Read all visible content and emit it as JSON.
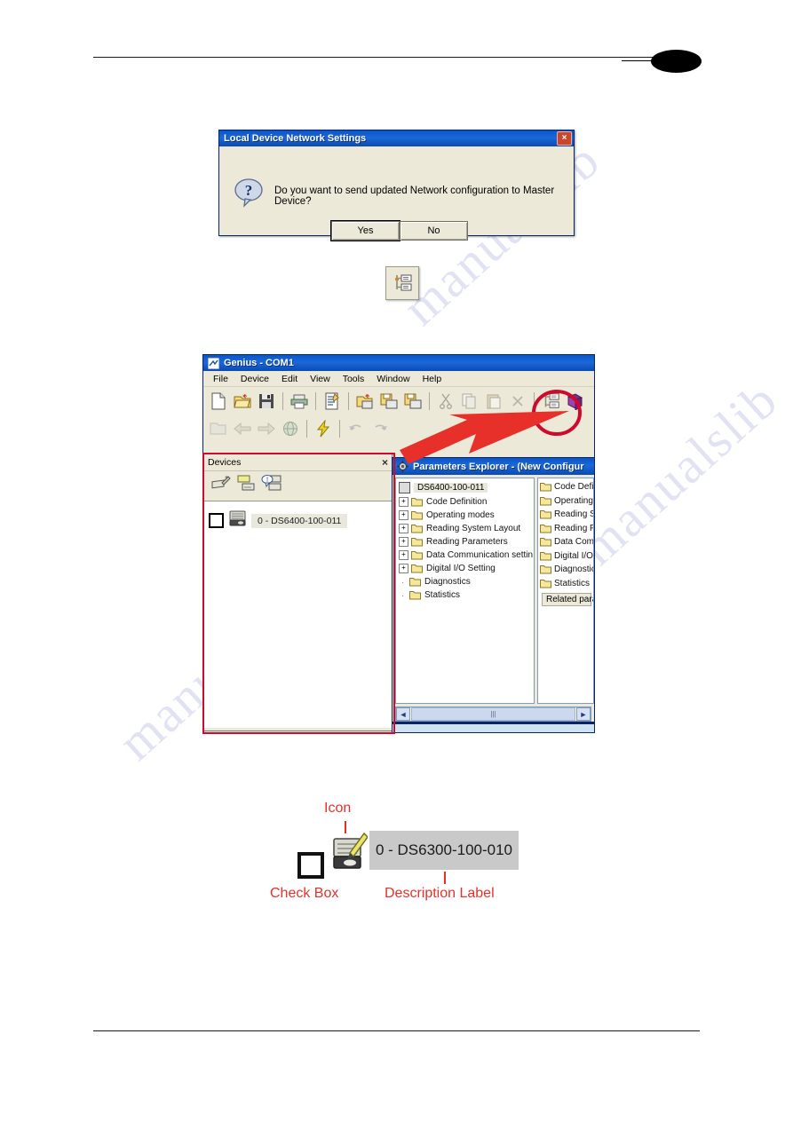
{
  "dialog": {
    "title": "Local Device Network Settings",
    "message": "Do you want to send updated Network configuration to Master Device?",
    "yes_label": "Yes",
    "no_label": "No",
    "close_label": "×",
    "icon": "question-icon"
  },
  "standalone_icon": {
    "name": "network-settings-icon"
  },
  "app": {
    "title": "Genius - COM1",
    "menu": [
      {
        "label": "File"
      },
      {
        "label": "Device"
      },
      {
        "label": "Edit"
      },
      {
        "label": "View"
      },
      {
        "label": "Tools"
      },
      {
        "label": "Window"
      },
      {
        "label": "Help"
      }
    ],
    "toolbar_row1": [
      {
        "name": "new-document-icon"
      },
      {
        "name": "open-folder-icon"
      },
      {
        "name": "save-icon"
      },
      {
        "name": "print-icon"
      },
      {
        "name": "properties-icon"
      },
      {
        "name": "open-from-device-icon"
      },
      {
        "name": "save-to-device-icon"
      },
      {
        "name": "save-all-icon"
      },
      {
        "name": "cut-icon"
      },
      {
        "name": "copy-icon"
      },
      {
        "name": "paste-icon"
      },
      {
        "name": "delete-icon"
      },
      {
        "name": "network-settings-icon"
      },
      {
        "name": "help-book-icon"
      }
    ],
    "toolbar_row2": [
      {
        "name": "open-config-icon"
      },
      {
        "name": "back-arrow-icon"
      },
      {
        "name": "forward-arrow-icon"
      },
      {
        "name": "globe-icon"
      },
      {
        "name": "lightning-icon"
      },
      {
        "name": "undo-icon"
      },
      {
        "name": "redo-icon"
      }
    ]
  },
  "devices_panel": {
    "title": "Devices",
    "close_label": "×",
    "tools": [
      {
        "name": "add-device-icon"
      },
      {
        "name": "device-list-icon"
      },
      {
        "name": "device-info-icon"
      }
    ],
    "device": {
      "label": "0 - DS6400-100-011",
      "checked": false
    }
  },
  "parameters_explorer": {
    "title": "Parameters Explorer - (New Configur",
    "root_label": "DS6400-100-011",
    "tree": [
      {
        "label": "Code Definition",
        "expandable": true
      },
      {
        "label": "Operating modes",
        "expandable": true
      },
      {
        "label": "Reading System Layout",
        "expandable": true
      },
      {
        "label": "Reading Parameters",
        "expandable": true
      },
      {
        "label": "Data Communication settin",
        "expandable": true
      },
      {
        "label": "Digital I/O Setting",
        "expandable": true
      },
      {
        "label": "Diagnostics",
        "expandable": false
      },
      {
        "label": "Statistics",
        "expandable": false
      }
    ],
    "right_list": [
      {
        "label": "Code Defi"
      },
      {
        "label": "Operating"
      },
      {
        "label": "Reading S"
      },
      {
        "label": "Reading P"
      },
      {
        "label": "Data Com"
      },
      {
        "label": "Digital I/O"
      },
      {
        "label": "Diagnostic"
      },
      {
        "label": "Statistics"
      }
    ],
    "related_label": "Related param",
    "scroll_left": "◄",
    "scroll_right": "►",
    "scroll_thumb": "|||"
  },
  "annotations": {
    "icon_label": "Icon",
    "checkbox_label": "Check Box",
    "description_label": "Description Label",
    "sample_device_label": "0 - DS6300-100-010",
    "accent_color": "#e8302a",
    "highlight_color": "#cf0a2c"
  },
  "watermarks": [
    {
      "text": "manualslib"
    },
    {
      "text": "manualslib"
    },
    {
      "text": "manualslib"
    }
  ]
}
